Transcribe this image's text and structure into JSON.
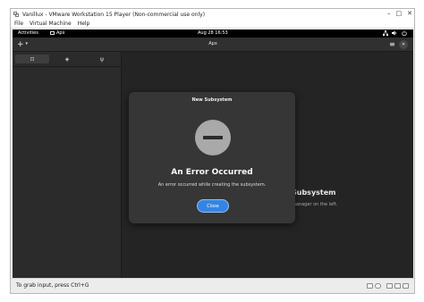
{
  "window": {
    "title": "Vanillux - VMware Workstation 15 Player (Non-commercial use only)",
    "minimize_glyph": "–",
    "maximize_glyph": "□",
    "close_glyph": "✕"
  },
  "menubar": {
    "items": [
      {
        "label": "File"
      },
      {
        "label": "Virtual Machine"
      },
      {
        "label": "Help"
      }
    ]
  },
  "topbar": {
    "activities": "Activities",
    "app_name": "Apx",
    "clock": "Aug 28  16:53"
  },
  "app_header": {
    "title": "Apx",
    "add_glyph": "+",
    "add_chevron_glyph": "▾",
    "menu_glyph": "≡",
    "close_glyph": "✕"
  },
  "sidebar": {
    "tabs": [
      {
        "name": "terminal",
        "glyph": "⊡",
        "selected": true
      },
      {
        "name": "packages",
        "glyph": "◈",
        "selected": false
      },
      {
        "name": "usb",
        "glyph": "ψ",
        "selected": false
      }
    ]
  },
  "background": {
    "heading_fragment": "Subsystem",
    "subtext_fragment": "manager on the left."
  },
  "dialog": {
    "title": "New Subsystem",
    "heading": "An Error Occurred",
    "message": "An error occurred while creating the subsystem.",
    "close_label": "Close"
  },
  "statusbar": {
    "hint": "To grab input, press Ctrl+G"
  },
  "colors": {
    "accent": "#3584e4",
    "dialog_bg": "#363636",
    "guest_bg": "#242424"
  }
}
